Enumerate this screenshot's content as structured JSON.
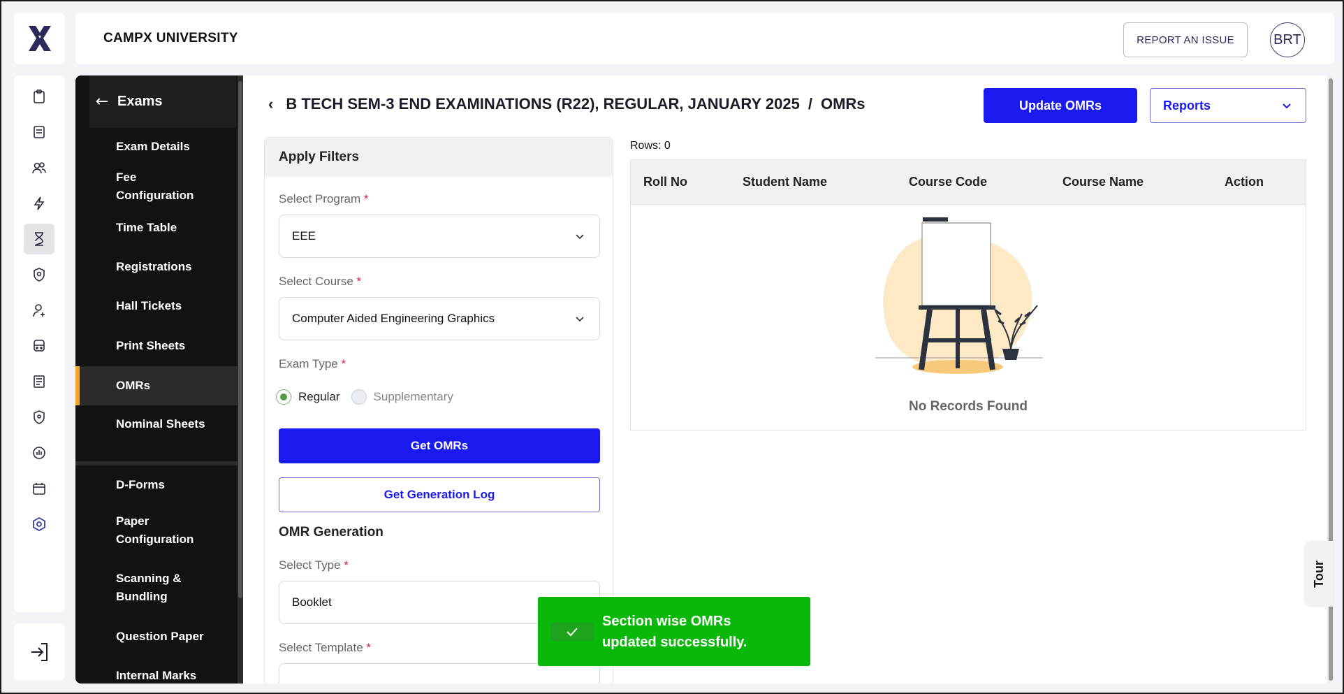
{
  "header": {
    "university": "CAMPX UNIVERSITY",
    "report_issue": "REPORT AN ISSUE",
    "avatar": "BRT"
  },
  "icon_rail": {
    "items": [
      "clipboard-icon",
      "notebook-icon",
      "users-icon",
      "bolt-icon",
      "hourglass-icon",
      "badge-icon",
      "user-add-icon",
      "bus-icon",
      "ledger-icon",
      "shield-pin-icon",
      "chart-icon",
      "calendar-icon",
      "settings-hex-icon"
    ],
    "active": "hourglass-icon",
    "logout_icon": "logout-icon"
  },
  "sidebar": {
    "title": "Exams",
    "items": [
      {
        "label": "Exam Details"
      },
      {
        "label": "Fee Configuration"
      },
      {
        "label": "Time Table"
      },
      {
        "label": "Registrations"
      },
      {
        "label": "Hall Tickets"
      },
      {
        "label": "Print Sheets"
      },
      {
        "label": "OMRs"
      },
      {
        "label": "Nominal Sheets"
      },
      {
        "label": "D-Forms"
      },
      {
        "label": "Paper Configuration"
      },
      {
        "label": "Scanning & Bundling"
      },
      {
        "label": "Question Paper"
      },
      {
        "label": "Internal Marks"
      }
    ],
    "active_item": "OMRs"
  },
  "page": {
    "title_main": "B TECH SEM-3 END EXAMINATIONS (R22), REGULAR, JANUARY 2025",
    "title_sep": "/",
    "title_sub": "OMRs",
    "update_button": "Update OMRs",
    "reports_button": "Reports"
  },
  "filters": {
    "heading": "Apply Filters",
    "program_label": "Select Program",
    "program_value": "EEE",
    "course_label": "Select Course",
    "course_value": "Computer Aided Engineering Graphics",
    "exam_type_label": "Exam Type",
    "exam_type_options": [
      "Regular",
      "Supplementary"
    ],
    "exam_type_selected": "Regular",
    "get_omrs": "Get OMRs",
    "get_log": "Get Generation Log",
    "omr_section": "OMR Generation",
    "type_label": "Select Type",
    "type_value": "Booklet",
    "template_label": "Select Template",
    "required_mark": "*"
  },
  "table": {
    "rows_label": "Rows: 0",
    "columns": [
      "Roll No",
      "Student Name",
      "Course Code",
      "Course Name",
      "Action"
    ],
    "empty_text": "No Records Found"
  },
  "toast": {
    "message": "Section wise OMRs updated successfully.",
    "color": "#0ab80a"
  },
  "tour": "Tour",
  "colors": {
    "primary": "#1a1aee",
    "accent": "#f5a623",
    "sidebar_bg": "#121212"
  }
}
